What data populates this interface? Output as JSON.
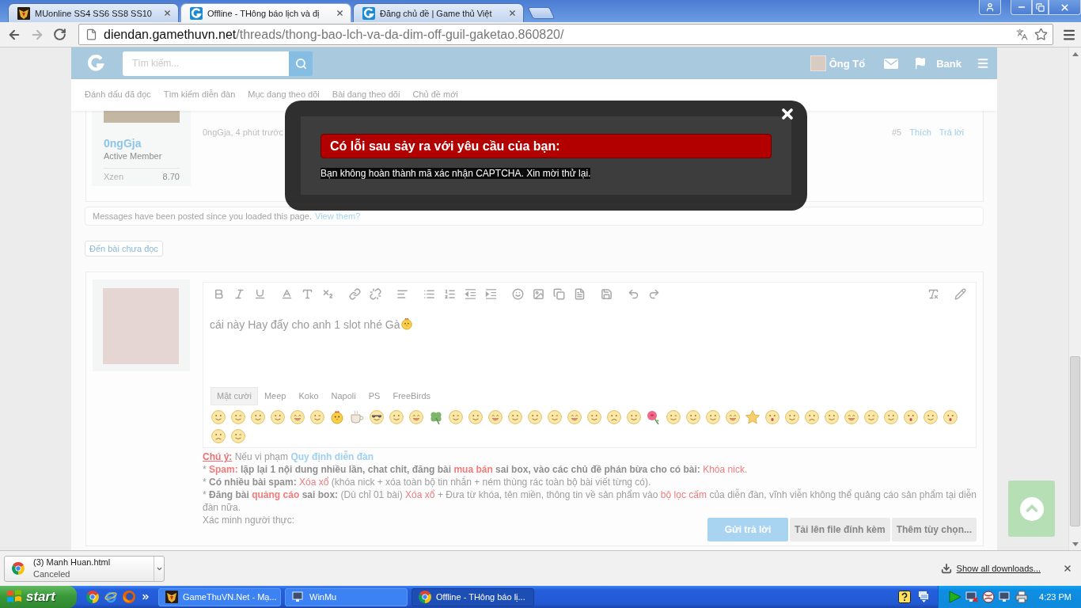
{
  "browser": {
    "tabs": [
      {
        "title": "MUonline SS4 SS6 SS8 SS10",
        "selected": false
      },
      {
        "title": "Offline - THông báo lịch và đị",
        "selected": true
      },
      {
        "title": "Đăng chủ đề | Game thủ Việt",
        "selected": false
      }
    ],
    "address": {
      "host": "diendan.gamethuvn.net",
      "path": "/threads/thong-bao-lch-va-da-dim-off-guil-gaketao.860820/"
    }
  },
  "site_header": {
    "search": {
      "placeholder": "Tìm kiếm..."
    },
    "user": "Ông Tổ",
    "bank": "Bank"
  },
  "subnav": [
    "Đánh dấu đã đọc",
    "Tìm kiếm diễn đàn",
    "Mục đang theo dõi",
    "Bài đang theo dõi",
    "Chủ đề mới"
  ],
  "post": {
    "author": "0ngGja",
    "rank": "Active Member",
    "stat": {
      "label": "Xzen",
      "value": "8.70"
    },
    "byline": "0ngGja, 4 phút trước",
    "number": "#5",
    "actions": [
      "Thích",
      "Trả lời"
    ]
  },
  "notice": {
    "text": "Messages have been posted since you loaded this page.",
    "link": "View them?"
  },
  "unread_button": "Đến bài chưa đọc",
  "editor": {
    "text": "cái này Hay đấy cho anh 1 slot nhé Gà",
    "smiley_tabs": [
      {
        "label": "Mặt cười",
        "selected": true
      },
      {
        "label": "Meep",
        "selected": false
      },
      {
        "label": "Koko",
        "selected": false
      },
      {
        "label": "Napoli",
        "selected": false
      },
      {
        "label": "PS",
        "selected": false
      },
      {
        "label": "FreeBirds",
        "selected": false
      }
    ]
  },
  "rules": [
    [
      {
        "kind": "label",
        "text": "Chú ý:"
      },
      {
        "kind": "plain",
        "text": " Nếu vi phạm "
      },
      {
        "kind": "link",
        "text": "Quy định diễn đàn"
      }
    ],
    [
      {
        "kind": "plain",
        "text": "* "
      },
      {
        "kind": "alert_bold",
        "text": "Spam:"
      },
      {
        "kind": "bold",
        "text": " lặp lại 1 nội dung nhiều lần, chat chit, đăng bài "
      },
      {
        "kind": "alert_bold",
        "text": "mua bán"
      },
      {
        "kind": "bold",
        "text": " sai box, vào các chủ đề phán bừa cho có bài:"
      },
      {
        "kind": "alert",
        "text": " Khóa nick."
      }
    ],
    [
      {
        "kind": "plain",
        "text": "* "
      },
      {
        "kind": "bold",
        "text": "Có nhiều bài spam:"
      },
      {
        "kind": "alert",
        "text": " Xóa xổ"
      },
      {
        "kind": "plain",
        "text": " (khóa nick + xóa toàn bộ tin nhắn + ném thùng rác toàn bộ bài viết từng có)."
      }
    ],
    [
      {
        "kind": "plain",
        "text": "* "
      },
      {
        "kind": "bold",
        "text": "Đăng bài "
      },
      {
        "kind": "alert_bold",
        "text": "quảng cáo"
      },
      {
        "kind": "bold",
        "text": " sai box:"
      },
      {
        "kind": "plain",
        "text": " (Dù chỉ 01 bài) "
      },
      {
        "kind": "alert",
        "text": "Xóa xổ"
      },
      {
        "kind": "plain",
        "text": " + Đưa từ khóa, tên miền, thông tin về sản phẩm vào "
      },
      {
        "kind": "alert",
        "text": "bộ lọc cấm"
      },
      {
        "kind": "plain",
        "text": " của diễn đàn, vĩnh viễn không thể quảng cáo sản phẩm tại diễn đàn nữa."
      }
    ]
  ],
  "captcha_label": "Xác minh người thực:",
  "buttons": [
    {
      "label": "Gửi trả lời",
      "kind": "primary"
    },
    {
      "label": "Tải lên file đính kèm",
      "kind": "secondary"
    },
    {
      "label": "Thêm tùy chọn...",
      "kind": "secondary"
    }
  ],
  "modal": {
    "title": "Có lỗi sau sảy ra với yêu cầu của bạn:",
    "message": "Bạn không hoàn thành mã xác nhận CAPTCHA. Xin mời thử lại."
  },
  "downloads": {
    "file": "(3) Manh Huan.html",
    "status": "Canceled",
    "show_all": "Show all downloads..."
  },
  "taskbar": {
    "start": "start",
    "windows": [
      {
        "title": "GameThuVN.Net - Mạ...",
        "selected": false
      },
      {
        "title": "WinMu",
        "selected": false
      },
      {
        "title": "Offline - THông báo lị...",
        "selected": true
      }
    ],
    "clock": "4:23 PM"
  }
}
